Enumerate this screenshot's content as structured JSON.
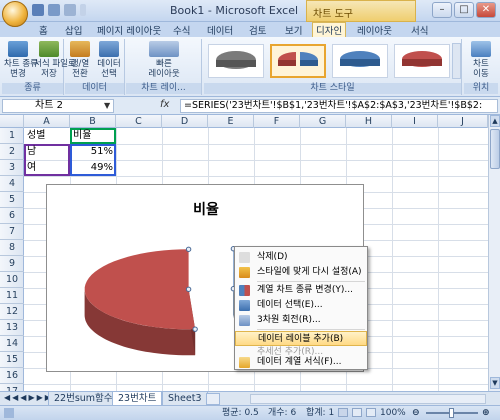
{
  "window": {
    "title": "Book1 - Microsoft Excel",
    "context_tab_group": "차트 도구"
  },
  "tabs": [
    "홈",
    "삽입",
    "페이지 레이아웃",
    "수식",
    "데이터",
    "검토",
    "보기",
    "디자인",
    "레이아웃",
    "서식"
  ],
  "active_tab": "디자인",
  "ribbon": {
    "groups": [
      {
        "label": "종류",
        "buttons": [
          "차트 종류\n변경",
          "서식 파일로\n저장"
        ]
      },
      {
        "label": "데이터",
        "buttons": [
          "행/열\n전환",
          "데이터\n선택"
        ]
      },
      {
        "label": "차트 레이...",
        "buttons": [
          "빠른\n레이아웃"
        ]
      },
      {
        "label": "차트 스타일",
        "buttons": []
      },
      {
        "label": "위치",
        "buttons": [
          "차트\n이동"
        ]
      }
    ]
  },
  "formula_bar": {
    "name_box": "차트 2",
    "fx": "fx",
    "formula": "=SERIES('23번차트'!$B$1,'23번차트'!$A$2:$A$3,'23번차트'!$B$2:"
  },
  "columns": [
    "A",
    "B",
    "C",
    "D",
    "E",
    "F",
    "G",
    "H",
    "I",
    "J"
  ],
  "rows": [
    "1",
    "2",
    "3",
    "4",
    "5",
    "6",
    "7",
    "8",
    "9",
    "10",
    "11",
    "12",
    "13",
    "14",
    "15",
    "16",
    "17"
  ],
  "cells": {
    "A1": "성별",
    "B1": "비율",
    "A2": "남",
    "B2": "51%",
    "A3": "여",
    "B3": "49%"
  },
  "chart_data": {
    "type": "pie",
    "title": "비율",
    "categories": [
      "남",
      "여"
    ],
    "values": [
      0.51,
      0.49
    ],
    "colors": [
      "#c0504d",
      "#4f81bd"
    ],
    "style": "3-D exploded pie"
  },
  "context_menu": {
    "items": [
      {
        "label": "삭제(D)",
        "enabled": true,
        "icon": "delete-icon"
      },
      {
        "label": "스타일에 맞게 다시 설정(A)",
        "enabled": true,
        "icon": "reset-style-icon"
      },
      {
        "label": "계열 차트 종류 변경(Y)...",
        "enabled": true,
        "icon": "chart-type-icon"
      },
      {
        "label": "데이터 선택(E)...",
        "enabled": true,
        "icon": "select-data-icon"
      },
      {
        "label": "3차원 회전(R)...",
        "enabled": true,
        "icon": "rotate-3d-icon"
      },
      {
        "label": "데이터 레이블 추가(B)",
        "enabled": true,
        "highlighted": true,
        "icon": ""
      },
      {
        "label": "추세선 추가(R)...",
        "enabled": false,
        "icon": ""
      },
      {
        "label": "데이터 계열 서식(F)...",
        "enabled": true,
        "icon": "format-series-icon"
      }
    ]
  },
  "sheet_tabs": [
    "22번sum함수",
    "23번차트",
    "Sheet3"
  ],
  "active_sheet": "23번차트",
  "status": {
    "average": "평균: 0.5",
    "count": "개수: 6",
    "sum": "합계: 1",
    "zoom": "100%"
  }
}
